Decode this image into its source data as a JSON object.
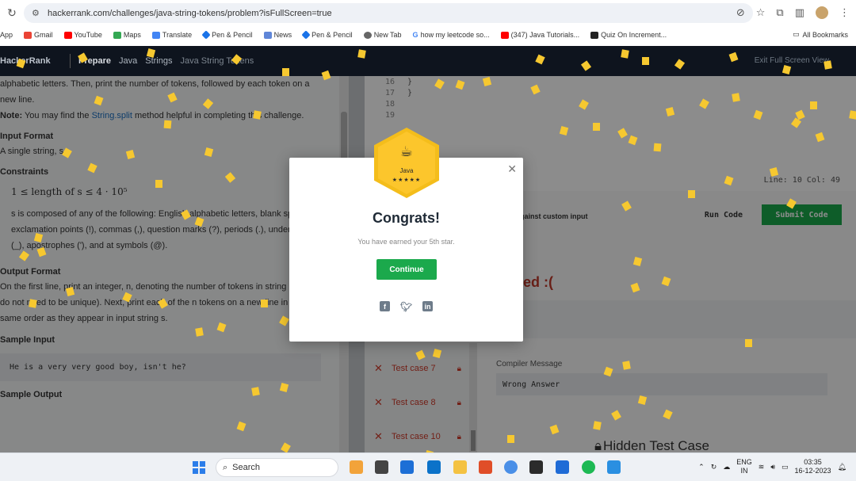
{
  "browser": {
    "url": "hackerrank.com/challenges/java-string-tokens/problem?isFullScreen=true",
    "bookmarks": [
      "App",
      "Gmail",
      "YouTube",
      "Maps",
      "Translate",
      "Pen & Pencil",
      "News",
      "Pen & Pencil",
      "New Tab",
      "how my leetcode so...",
      "(347) Java Tutorials...",
      "Quiz On Increment..."
    ],
    "all_bookmarks": "All Bookmarks"
  },
  "header": {
    "logo": "HackerRank",
    "crumbs": [
      "Prepare",
      "Java",
      "Strings",
      "Java String Tokens"
    ],
    "exit": "Exit Full Screen View"
  },
  "problem": {
    "intro_line1": "alphabetic letters. Then, print the number of tokens, followed by each token on a",
    "intro_line2": "new line.",
    "note_label": "Note:",
    "note_pre": "You may find the",
    "note_link": "String.split",
    "note_post": "method helpful in completing this challenge.",
    "input_format_title": "Input Format",
    "input_format_text": "A single string, s.",
    "constraints_title": "Constraints",
    "constraint1": "1 ≤ length of s ≤ 4 · 10⁵",
    "constraint2_line1": "s is composed of any of the following: English alphabetic letters, blank spa",
    "constraint2_line2": "exclamation points (!), commas (,), question marks (?), periods (.), under",
    "constraint2_line3": "(_), apostrophes ('), and at symbols (@).",
    "output_format_title": "Output Format",
    "output_line1": "On the first line, print an integer, n, denoting the number of tokens in string",
    "output_line2": "do not need to be unique). Next, print each of the n tokens on a new line in t",
    "output_line3": "same order as they appear in input string s.",
    "sample_input_title": "Sample Input",
    "sample_input": "He is a very very good boy, isn't he?",
    "sample_output_title": "Sample Output"
  },
  "editor": {
    "lines": [
      {
        "n": "16",
        "code": "    }"
      },
      {
        "n": "17",
        "code": "}"
      },
      {
        "n": "18",
        "code": ""
      },
      {
        "n": "19",
        "code": ""
      }
    ],
    "line_col": "Line: 10 Col: 49",
    "custom_input": "gainst custom input",
    "run_label": "Run Code",
    "submit_label": "Submit Code",
    "status": "ed :("
  },
  "testcases": [
    "Test case 7",
    "Test case 8",
    "Test case 10"
  ],
  "compiler": {
    "label": "Compiler Message",
    "message": "Wrong Answer",
    "hidden": "Hidden Test Case"
  },
  "modal": {
    "badge_lang": "Java",
    "badge_stars": "★★★★★",
    "title": "Congrats!",
    "subtitle": "You have earned your 5th star.",
    "continue_label": "Continue"
  },
  "taskbar": {
    "search_placeholder": "Search",
    "lang": "ENG",
    "region": "IN",
    "time": "03:35",
    "date": "16-12-2023"
  },
  "colors": {
    "accent_green": "#1ba94c",
    "badge_gold": "#fcc62c",
    "error_red": "#d03b2b",
    "header_dark": "#0e141e"
  }
}
